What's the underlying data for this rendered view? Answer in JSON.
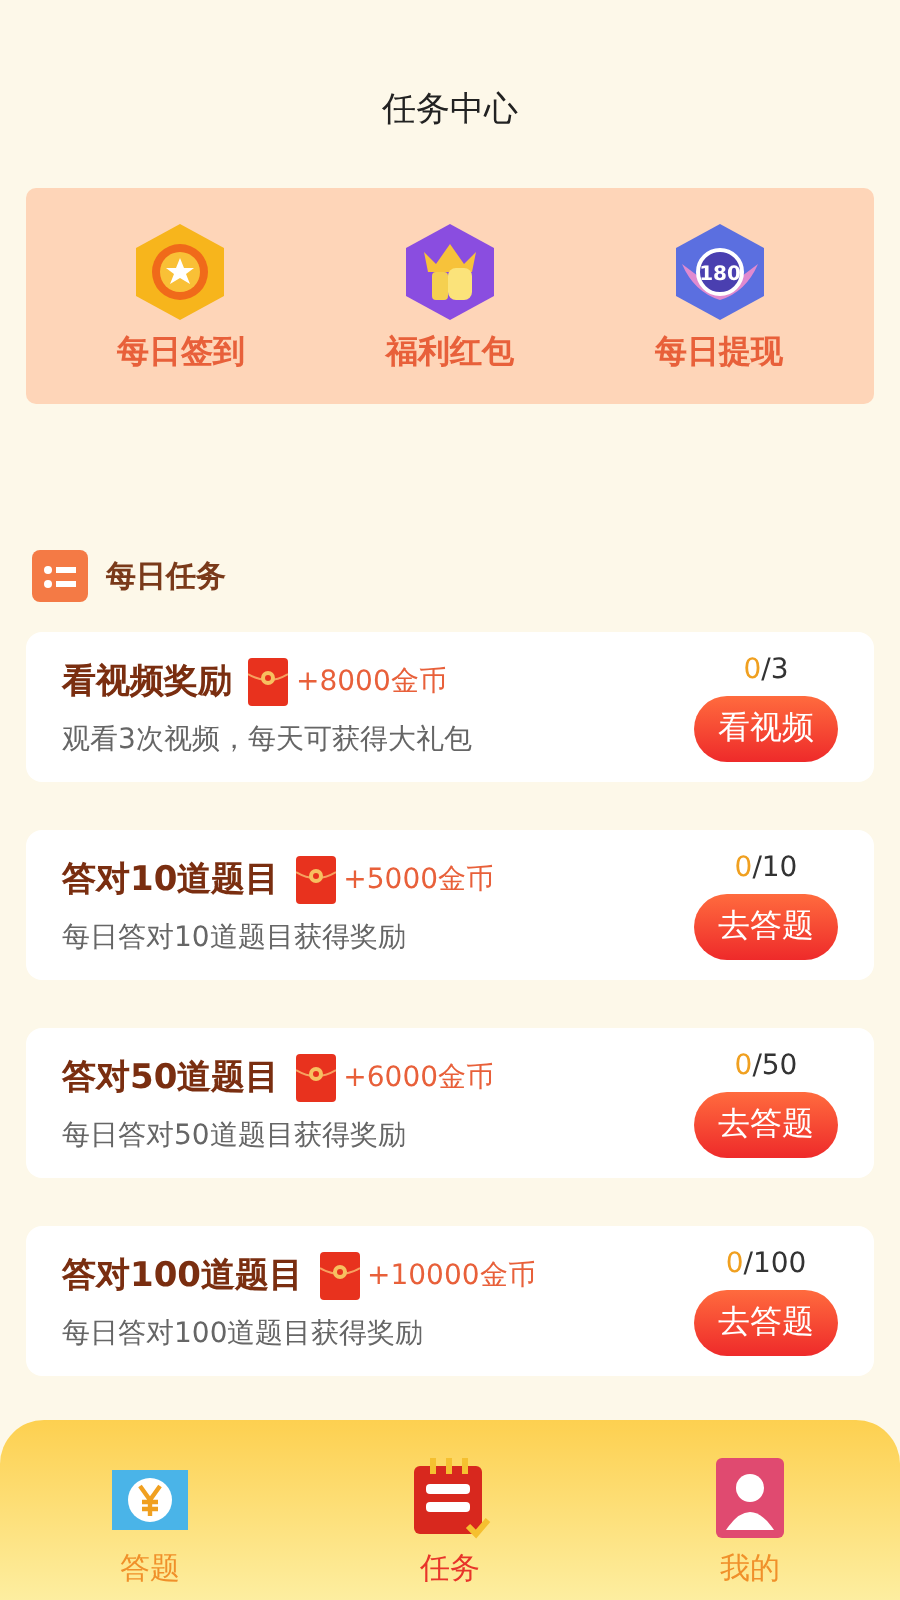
{
  "title": "任务中心",
  "shortcuts": [
    {
      "label": "每日签到",
      "kind": "star"
    },
    {
      "label": "福利红包",
      "kind": "thumb"
    },
    {
      "label": "每日提现",
      "kind": "badge",
      "badge_text": "180"
    }
  ],
  "section": {
    "title": "每日任务"
  },
  "tasks": [
    {
      "title": "看视频奖励",
      "reward": "+8000金币",
      "desc": "观看3次视频，每天可获得大礼包",
      "done": "0",
      "total": "/3",
      "button": "看视频"
    },
    {
      "title": "答对10道题目",
      "reward": "+5000金币",
      "desc": "每日答对10道题目获得奖励",
      "done": "0",
      "total": "/10",
      "button": "去答题"
    },
    {
      "title": "答对50道题目",
      "reward": "+6000金币",
      "desc": "每日答对50道题目获得奖励",
      "done": "0",
      "total": "/50",
      "button": "去答题"
    },
    {
      "title": "答对100道题目",
      "reward": "+10000金币",
      "desc": "每日答对100道题目获得奖励",
      "done": "0",
      "total": "/100",
      "button": "去答题"
    }
  ],
  "tabs": [
    {
      "label": "答题",
      "kind": "quiz",
      "selected": false
    },
    {
      "label": "任务",
      "kind": "task",
      "selected": true
    },
    {
      "label": "我的",
      "kind": "me",
      "selected": false
    }
  ]
}
